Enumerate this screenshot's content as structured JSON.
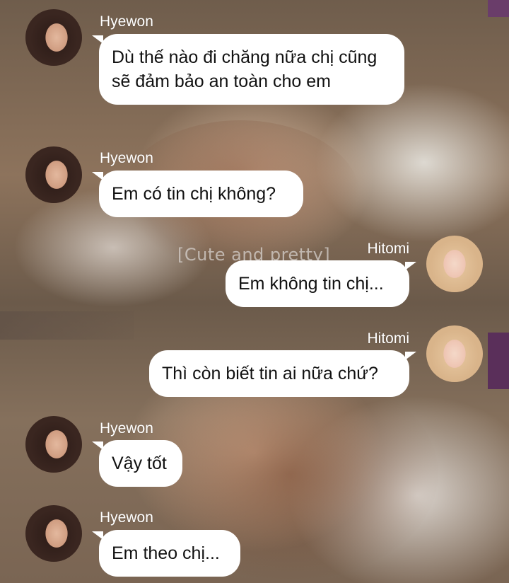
{
  "conversation": [
    {
      "sender": "Hyewon",
      "text": "Dù thế nào đi chăng nữa chị cũng sẽ đảm bảo an toàn cho em"
    },
    {
      "sender": "Hyewon",
      "text": "Em có tin chị không?"
    },
    {
      "sender": "Hitomi",
      "text": "Em không tin chị..."
    },
    {
      "sender": "Hitomi",
      "text": "Thì còn biết tin ai nữa chứ?"
    },
    {
      "sender": "Hyewon",
      "text": "Vậy tốt"
    },
    {
      "sender": "Hyewon",
      "text": "Em theo chị..."
    }
  ],
  "background": {
    "caption": "[Cute and pretty]"
  },
  "colors": {
    "bubble": "#ffffff",
    "name_text": "#ffffff",
    "message_text": "#111111"
  }
}
